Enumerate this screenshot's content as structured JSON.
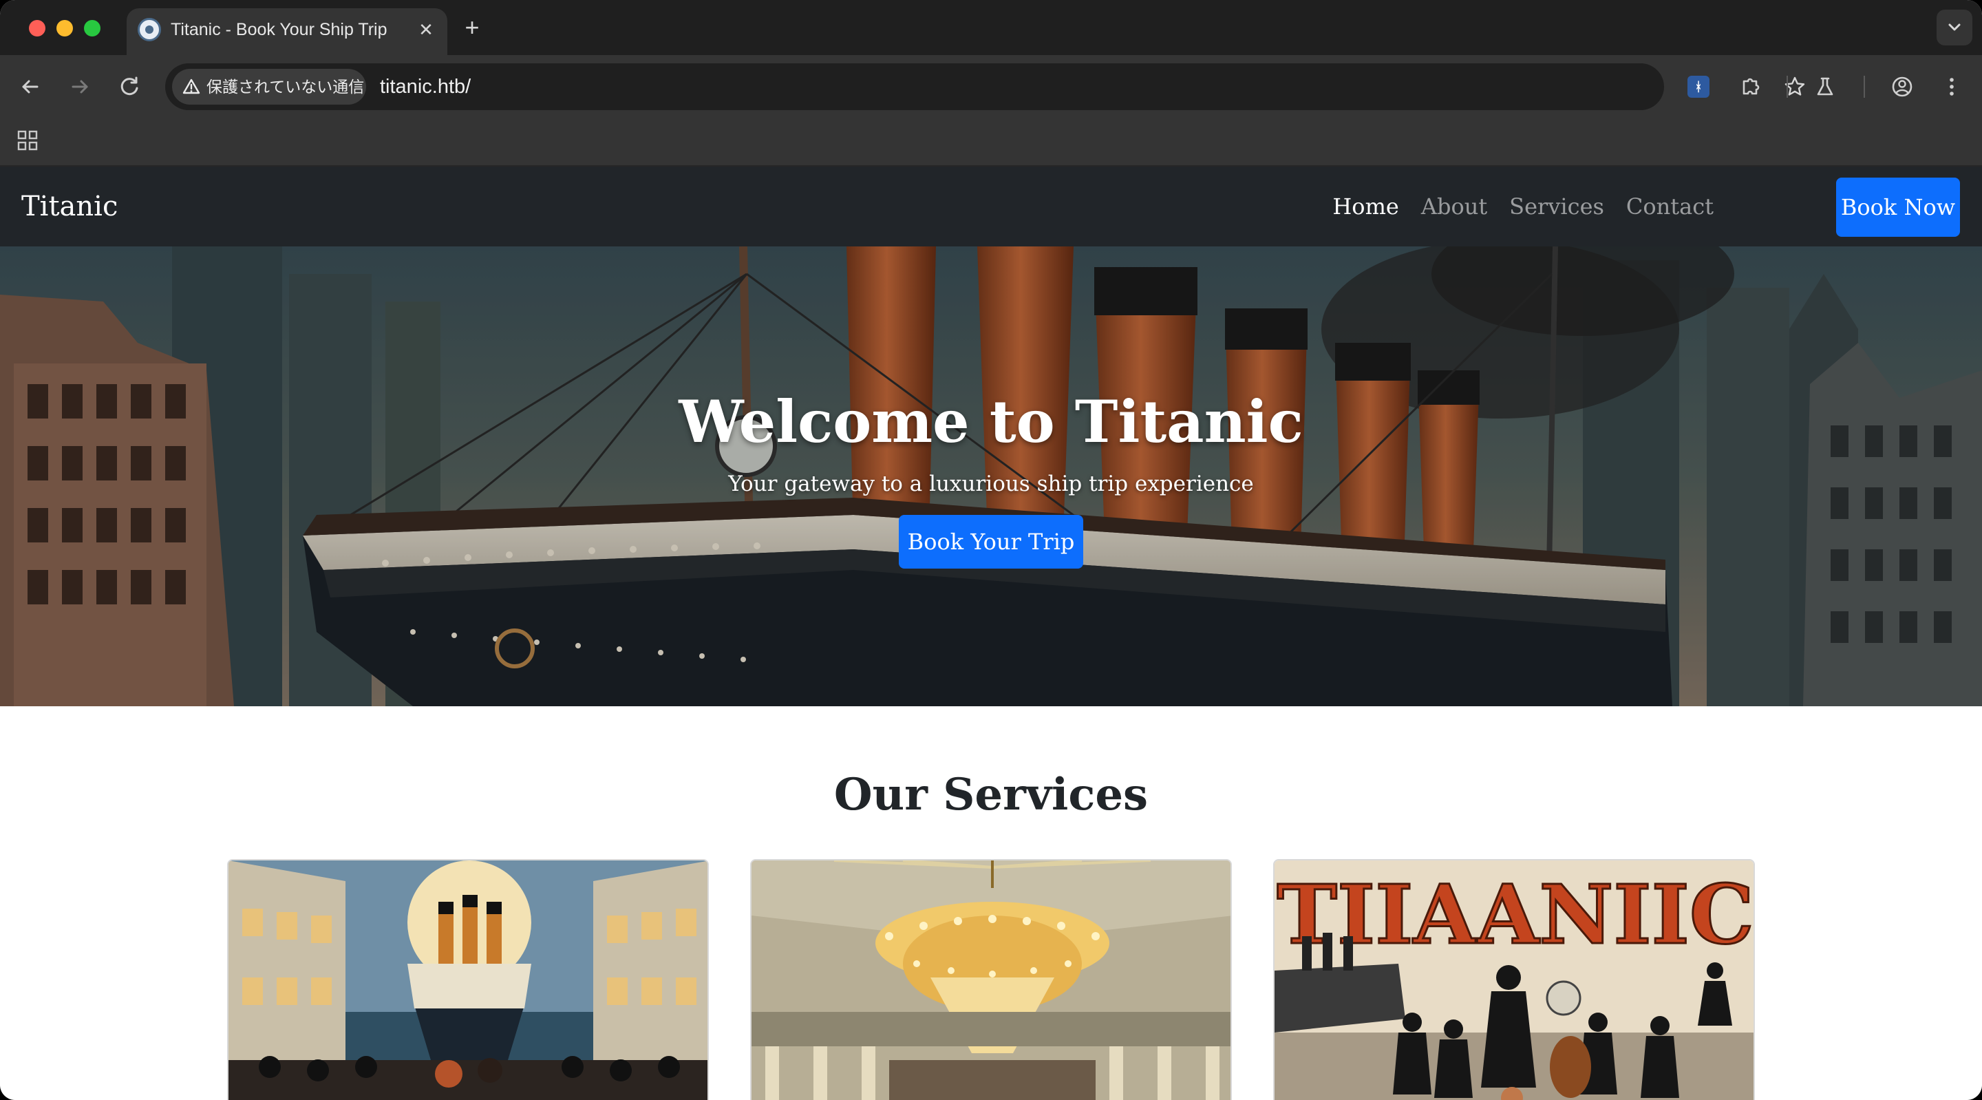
{
  "browser": {
    "tab_title": "Titanic - Book Your Ship Trip",
    "tab_close": "✕",
    "new_tab": "+",
    "security_label": "保護されていない通信",
    "url": "titanic.htb/",
    "extension_badge": "ᚼ"
  },
  "site": {
    "brand": "Titanic",
    "nav": {
      "home": "Home",
      "about": "About",
      "services": "Services",
      "contact": "Contact",
      "book_now": "Book Now"
    },
    "hero": {
      "title": "Welcome to Titanic",
      "subtitle": "Your gateway to a luxurious ship trip experience",
      "cta": "Book Your Trip"
    },
    "services": {
      "title": "Our Services",
      "cards": [
        {
          "image": "promenade-deck-poster"
        },
        {
          "image": "grand-ballroom-chandelier"
        },
        {
          "image": "ship-entertainment-poster",
          "poster_text": "TIIAANIIC"
        }
      ]
    }
  },
  "colors": {
    "navbar": "#212529",
    "primary": "#0d6efd",
    "chrome_dark": "#1f1f1f",
    "chrome_toolbar": "#343434"
  }
}
